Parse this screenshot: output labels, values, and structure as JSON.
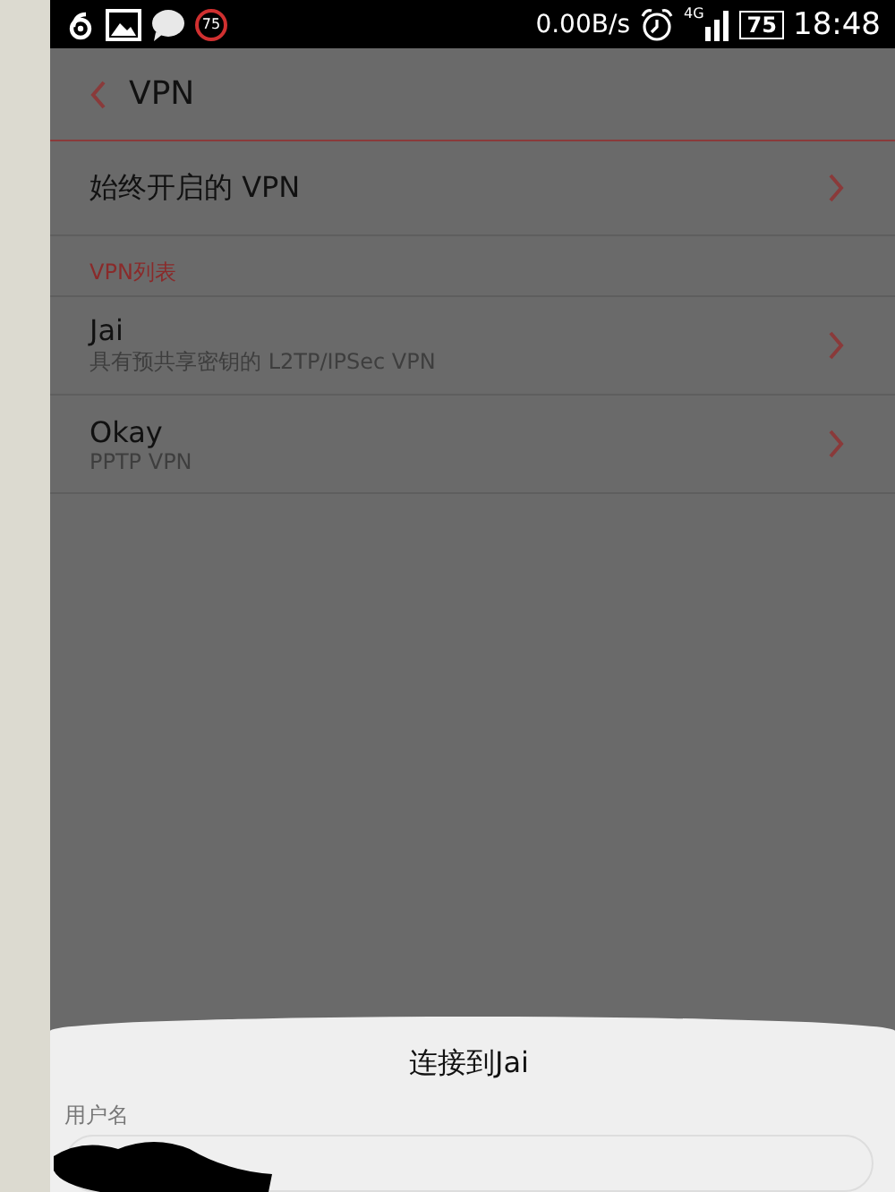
{
  "status_bar": {
    "notification_badge": "75",
    "speed": "0.00B/s",
    "network": "4G",
    "battery": "75",
    "time": "18:48"
  },
  "header": {
    "title": "VPN"
  },
  "always_on": {
    "label": "始终开启的 VPN"
  },
  "section": {
    "title": "VPN列表"
  },
  "vpn_list": [
    {
      "name": "Jai",
      "type": "具有预共享密钥的 L2TP/IPSec VPN"
    },
    {
      "name": "Okay",
      "type": "PPTP VPN"
    }
  ],
  "dialog": {
    "title": "连接到Jai",
    "fields": [
      {
        "label": "用户名"
      }
    ]
  }
}
